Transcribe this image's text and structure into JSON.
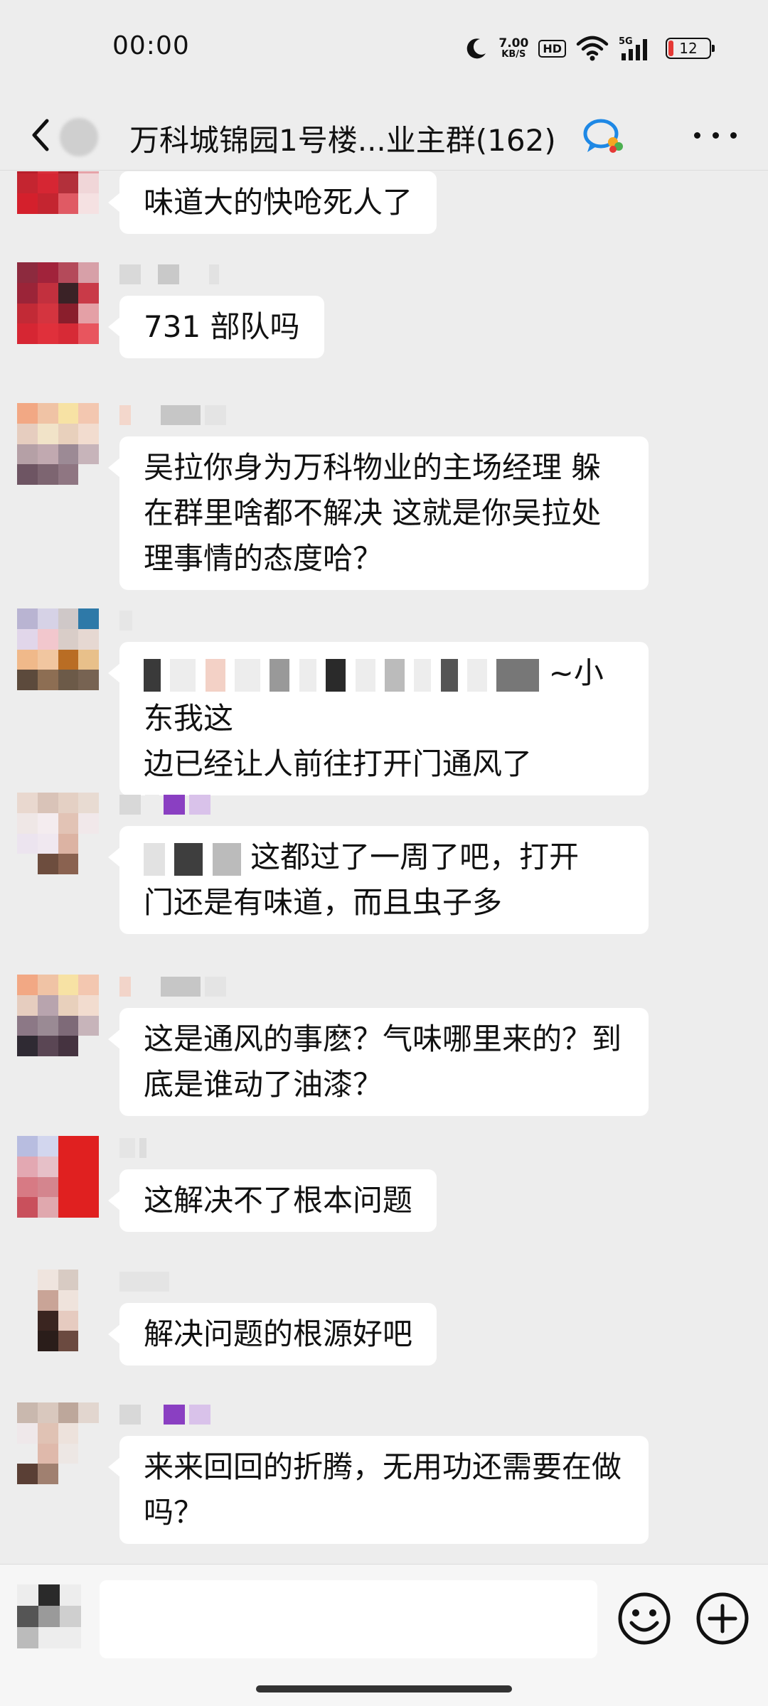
{
  "status_bar": {
    "time": "00:00",
    "net_speed": "7.00",
    "net_speed_unit": "KB/S",
    "hd_label": "HD",
    "network_label": "5G",
    "battery_level": "12",
    "battery_fraction": 0.12
  },
  "title_bar": {
    "title": "万科城锦园1号楼...业主群(162)",
    "icons": [
      "back-icon",
      "group-chat-icon",
      "more-icon"
    ]
  },
  "messages": [
    {
      "text": "味道大的快呛死人了"
    },
    {
      "text": "731 部队吗"
    },
    {
      "text": "吴拉你身为万科物业的主场经理 躲在群里啥都不解决 这就是你吴拉处理事情的态度哈？"
    },
    {
      "text_line1": "~小东我这",
      "text_line2": "边已经让人前往打开门通风了"
    },
    {
      "text_line1": "这都过了一周了吧，打开",
      "text_line2": "门还是有味道，而且虫子多"
    },
    {
      "text": "这是通风的事麽？气味哪里来的？到底是谁动了油漆？"
    },
    {
      "text": "这解决不了根本问题"
    },
    {
      "text": "解决问题的根源好吧"
    },
    {
      "text": "来来回回的折腾，无用功还需要在做吗？"
    }
  ],
  "input_bar": {
    "placeholder": "",
    "icons": [
      "emoji-icon",
      "plus-icon"
    ]
  },
  "colors": {
    "background": "#ededed",
    "bubble": "#ffffff",
    "title_accent": "#1e88e5",
    "battery_low": "#e53935"
  }
}
